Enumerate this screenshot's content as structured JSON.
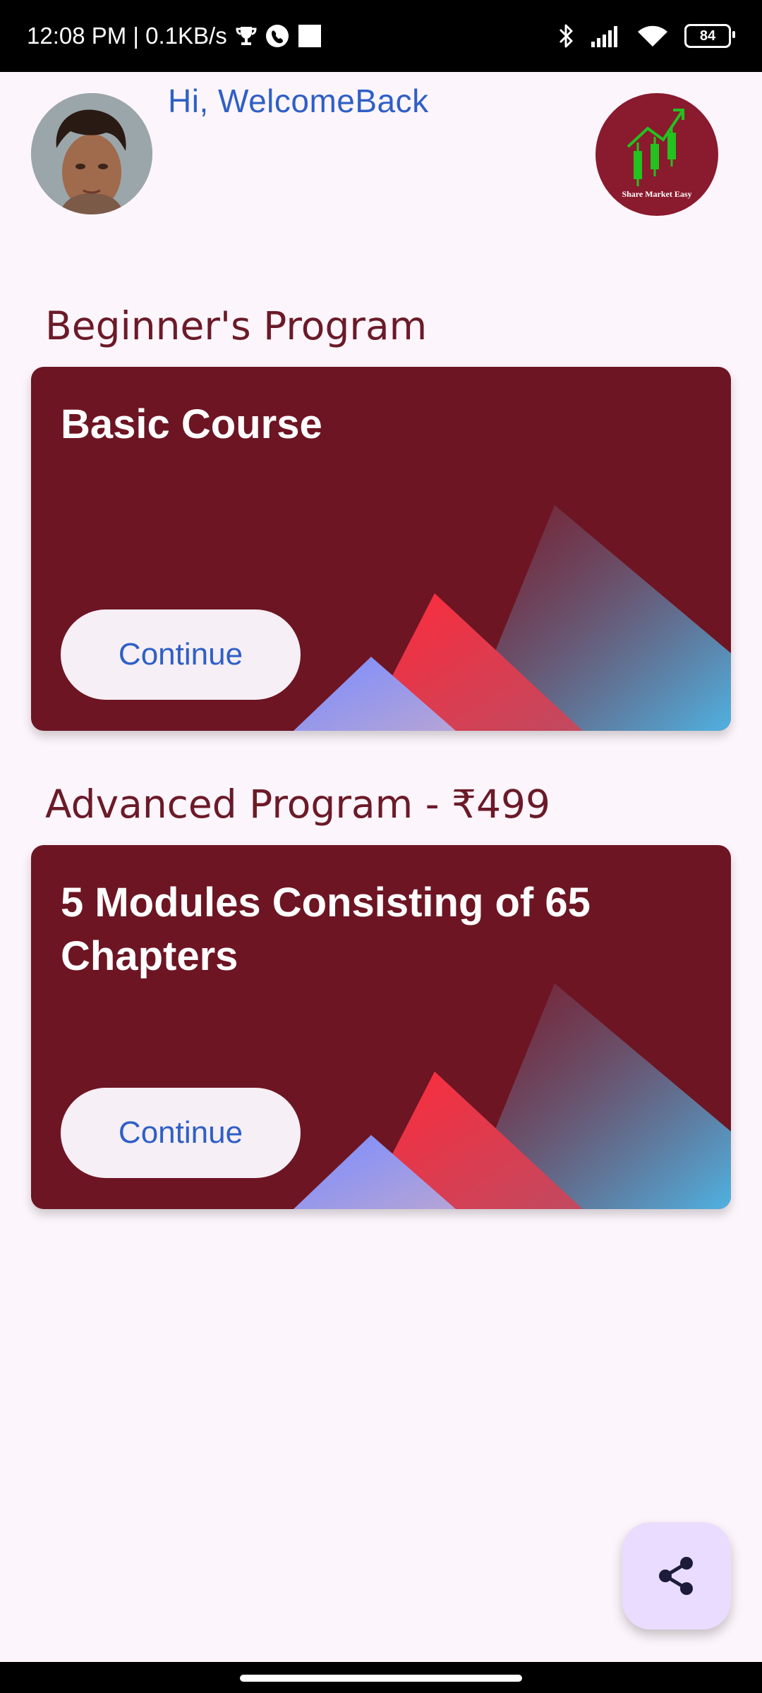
{
  "status_bar": {
    "time_speed": "12:08 PM | 0.1KB/s",
    "battery": "84"
  },
  "header": {
    "greeting": "Hi, WelcomeBack",
    "logo_text": "Share Market Easy"
  },
  "sections": [
    {
      "title": "Beginner's Program",
      "card_title": "Basic Course",
      "button": "Continue"
    },
    {
      "title": "Advanced Program - ₹499",
      "card_title": "5 Modules Consisting of 65 Chapters",
      "button": "Continue"
    }
  ],
  "fab": {
    "icon": "share-icon"
  },
  "colors": {
    "background": "#fcf5fb",
    "card": "#6d1523",
    "accent_text": "#2f5fc6",
    "section_title": "#6b1a28",
    "fab": "#eadcff"
  }
}
